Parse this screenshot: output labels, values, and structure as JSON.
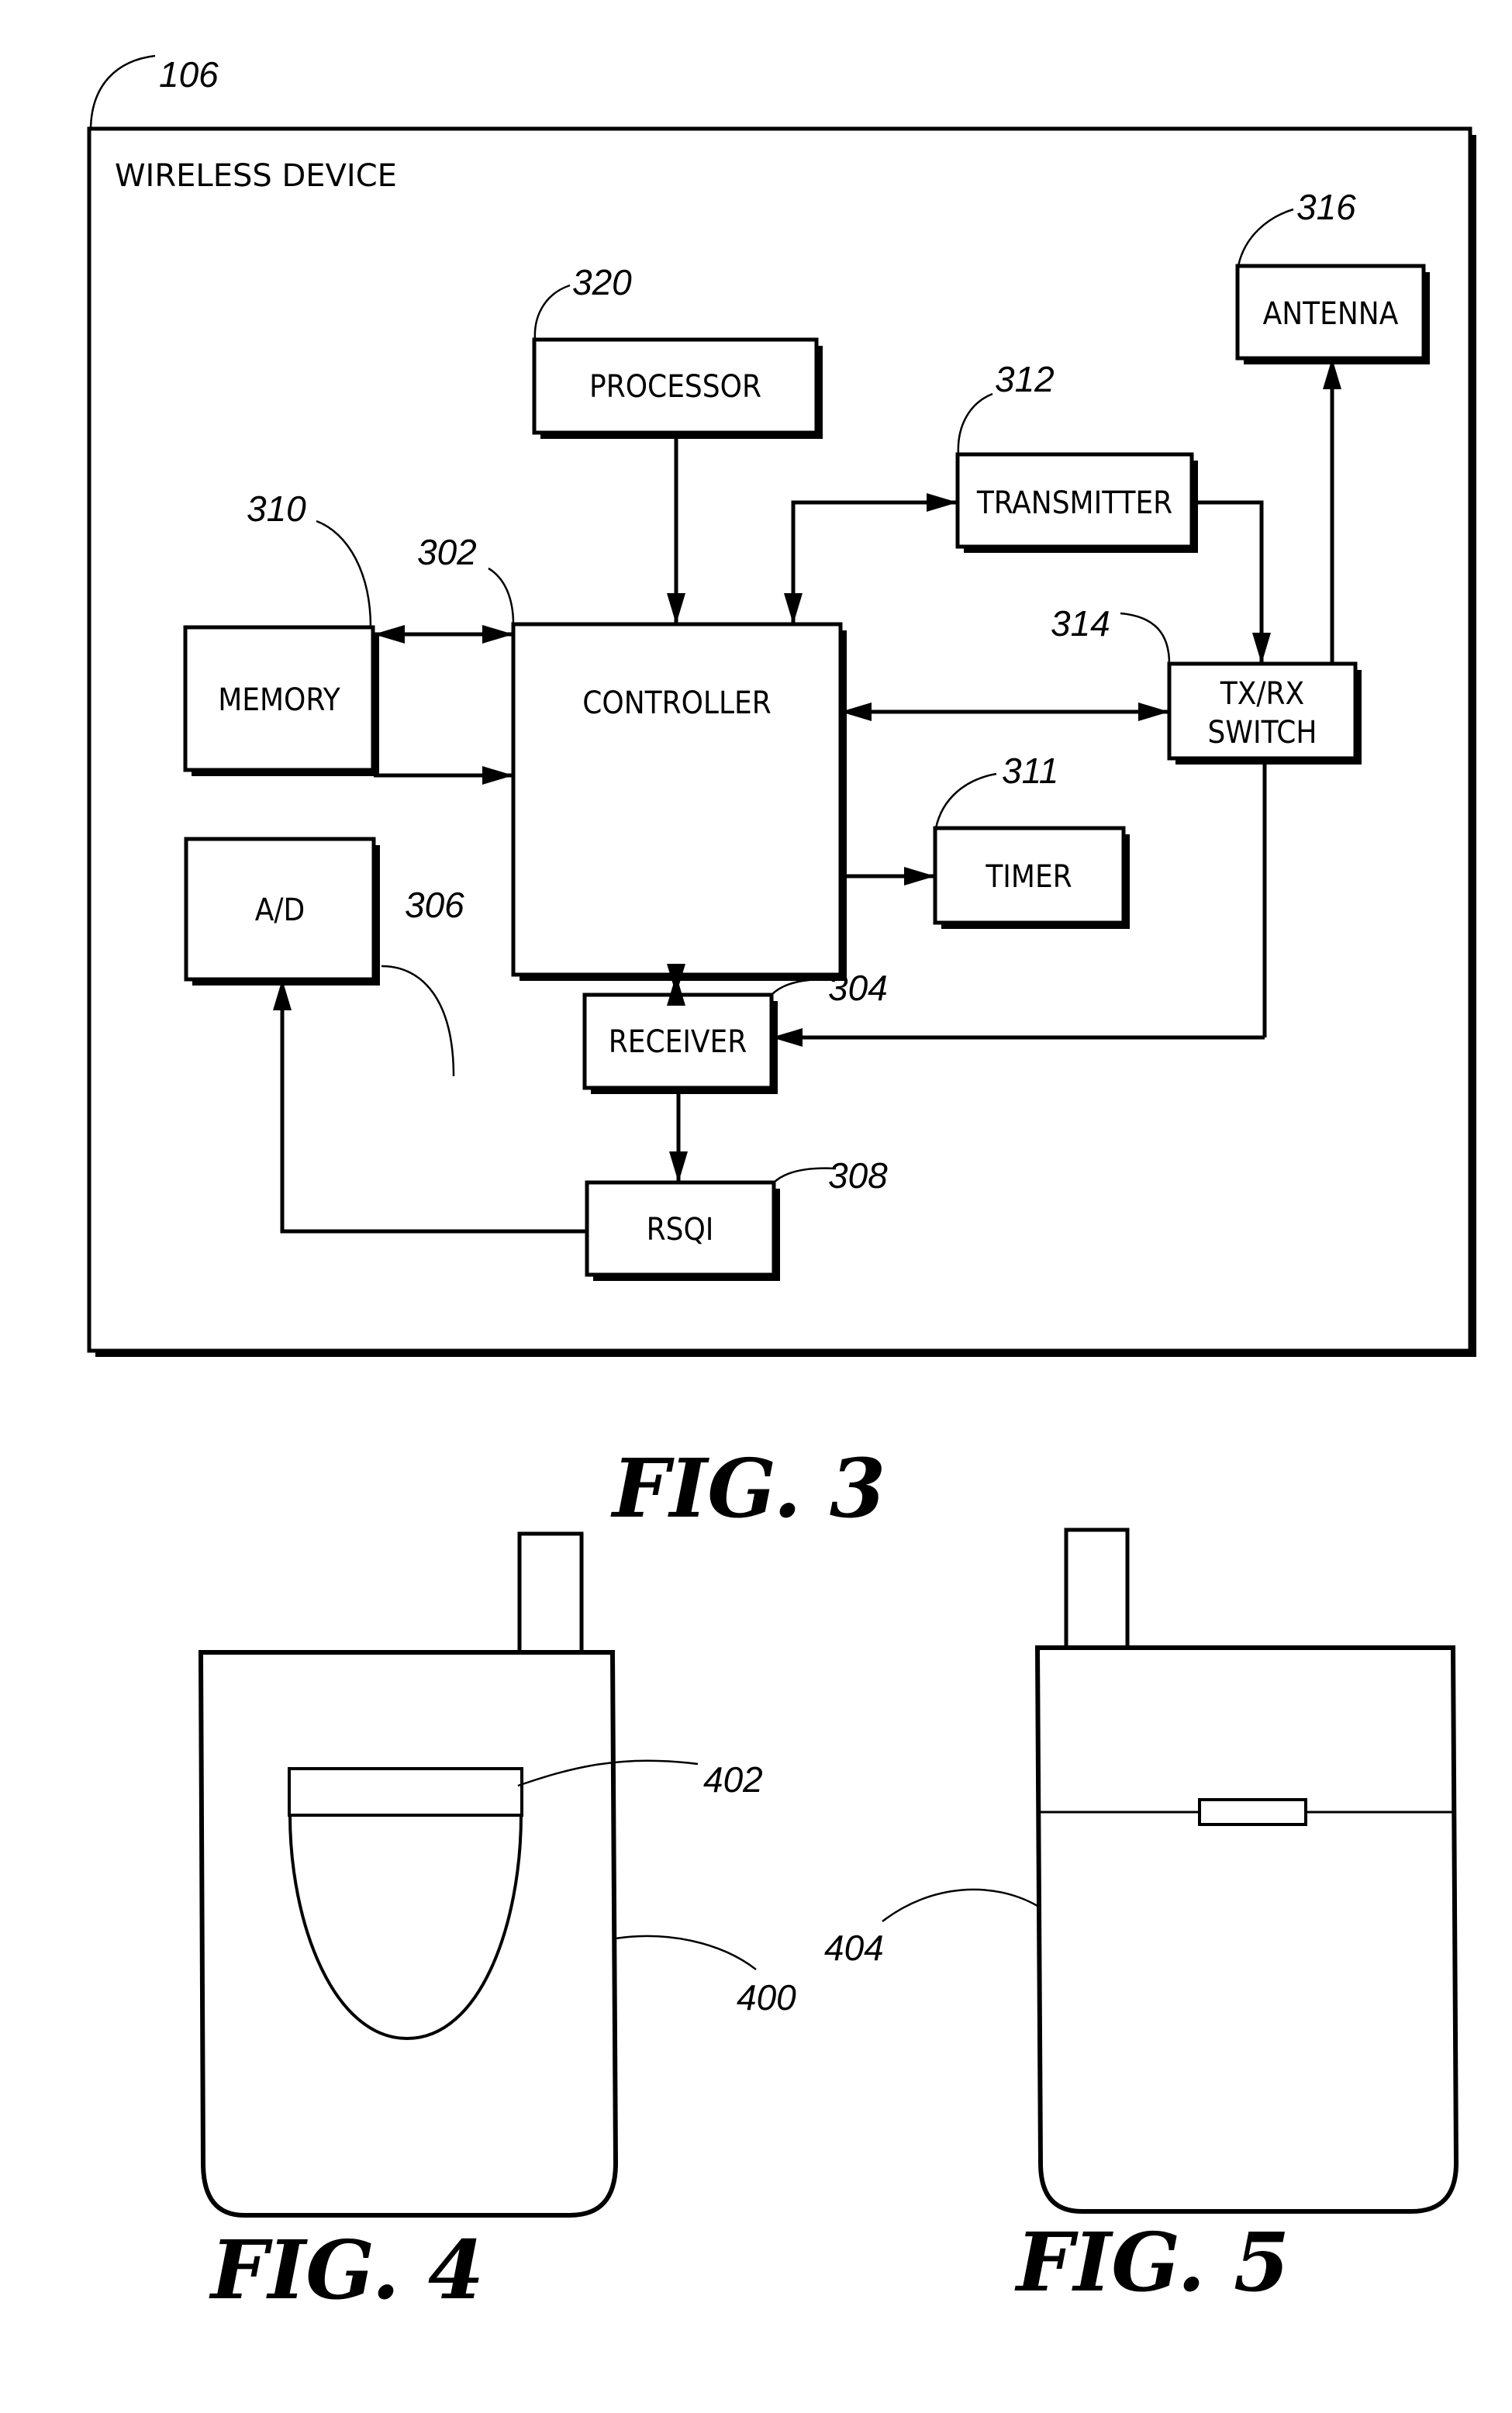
{
  "fig3": {
    "caption": "FIG. 3",
    "container": {
      "label": "WIRELESS DEVICE",
      "ref": "106"
    },
    "blocks": {
      "processor": {
        "label": "PROCESSOR",
        "ref": "320"
      },
      "memory": {
        "label": "MEMORY",
        "ref": "310"
      },
      "controller": {
        "label": "CONTROLLER",
        "ref": "302"
      },
      "ad": {
        "label": "A/D",
        "ref": "306"
      },
      "transmitter": {
        "label": "TRANSMITTER",
        "ref": "312"
      },
      "antenna": {
        "label": "ANTENNA",
        "ref": "316"
      },
      "switch": {
        "label_line1": "TX/RX",
        "label_line2": "SWITCH",
        "ref": "314"
      },
      "timer": {
        "label": "TIMER",
        "ref": "311"
      },
      "receiver": {
        "label": "RECEIVER",
        "ref": "304"
      },
      "rsqi": {
        "label": "RSQI",
        "ref": "308"
      }
    },
    "connections": [
      {
        "from": "processor",
        "to": "controller",
        "dir": "one-way"
      },
      {
        "from": "memory",
        "to": "controller",
        "dir": "two-way"
      },
      {
        "from": "ad",
        "to": "controller",
        "dir": "one-way"
      },
      {
        "from": "controller",
        "to": "transmitter",
        "dir": "two-way"
      },
      {
        "from": "transmitter",
        "to": "switch",
        "dir": "one-way"
      },
      {
        "from": "switch",
        "to": "antenna",
        "dir": "one-way"
      },
      {
        "from": "controller",
        "to": "switch",
        "dir": "two-way"
      },
      {
        "from": "controller",
        "to": "timer",
        "dir": "one-way"
      },
      {
        "from": "controller",
        "to": "receiver",
        "dir": "two-way"
      },
      {
        "from": "switch",
        "to": "receiver",
        "dir": "one-way"
      },
      {
        "from": "receiver",
        "to": "rsqi",
        "dir": "one-way"
      },
      {
        "from": "rsqi",
        "to": "ad",
        "dir": "one-way"
      }
    ]
  },
  "fig4": {
    "caption": "FIG. 4",
    "device_ref": "400",
    "display_ref": "402"
  },
  "fig5": {
    "caption": "FIG. 5",
    "device_ref": "404"
  }
}
